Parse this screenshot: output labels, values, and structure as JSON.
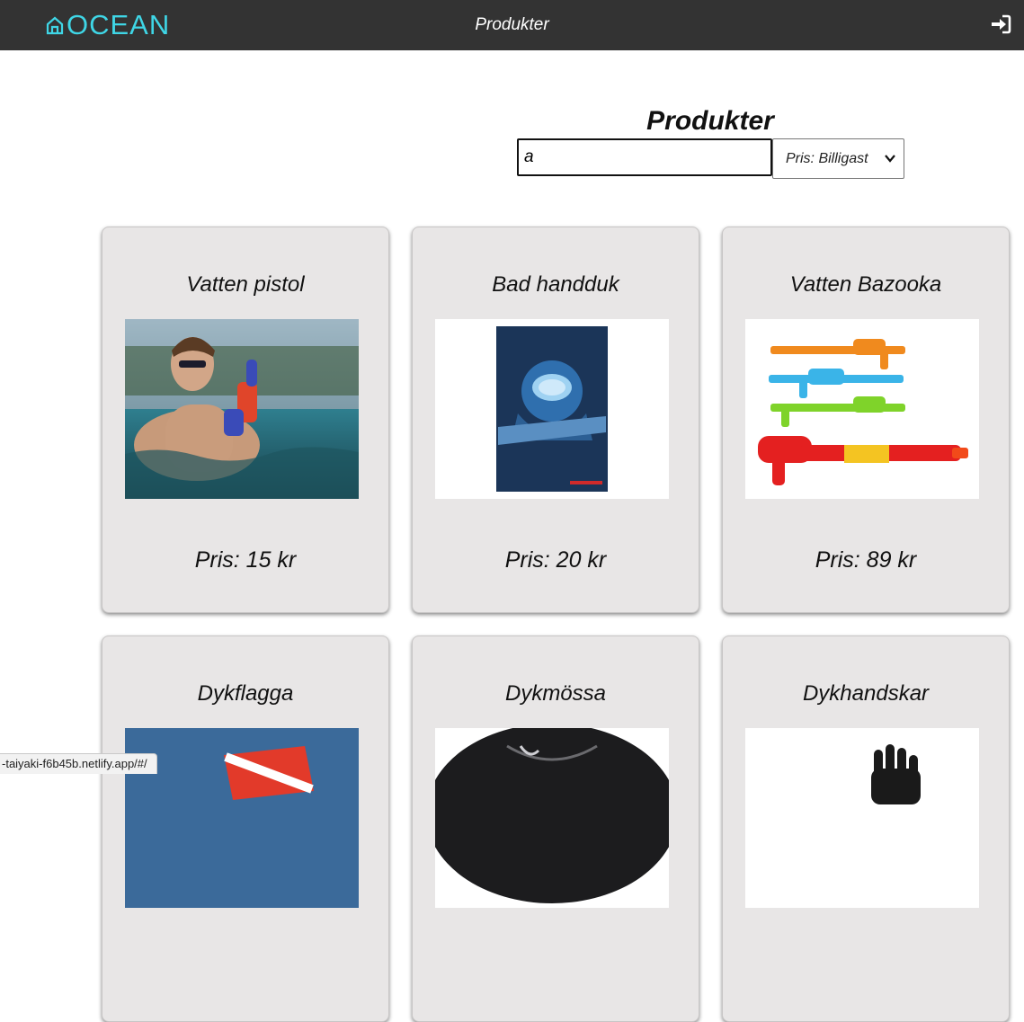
{
  "navbar": {
    "logo_text": "OCEAN",
    "title": "Produkter",
    "icons": {
      "home": "home-icon",
      "login": "sign-in-icon"
    },
    "colors": {
      "background": "#333333",
      "logo": "#3fd6e6"
    }
  },
  "page": {
    "heading": "Produkter",
    "search": {
      "value": "a"
    },
    "sort": {
      "selected": "Pris: Billigast"
    }
  },
  "products": [
    {
      "name": "Vatten pistol",
      "price": "Pris: 15 kr",
      "image": "man-in-pool-with-water-gun"
    },
    {
      "name": "Bad handduk",
      "price": "Pris: 20 kr",
      "image": "dive-vader-towel"
    },
    {
      "name": "Vatten Bazooka",
      "price": "Pris: 89 kr",
      "image": "colorful-water-guns"
    },
    {
      "name": "Dykflagga",
      "image": "diver-down-flag"
    },
    {
      "name": "Dykmössa",
      "image": "neoprene-dive-hood"
    },
    {
      "name": "Dykhandskar",
      "image": "dive-gloves"
    }
  ],
  "status_bar": {
    "url": "-taiyaki-f6b45b.netlify.app/#/"
  }
}
